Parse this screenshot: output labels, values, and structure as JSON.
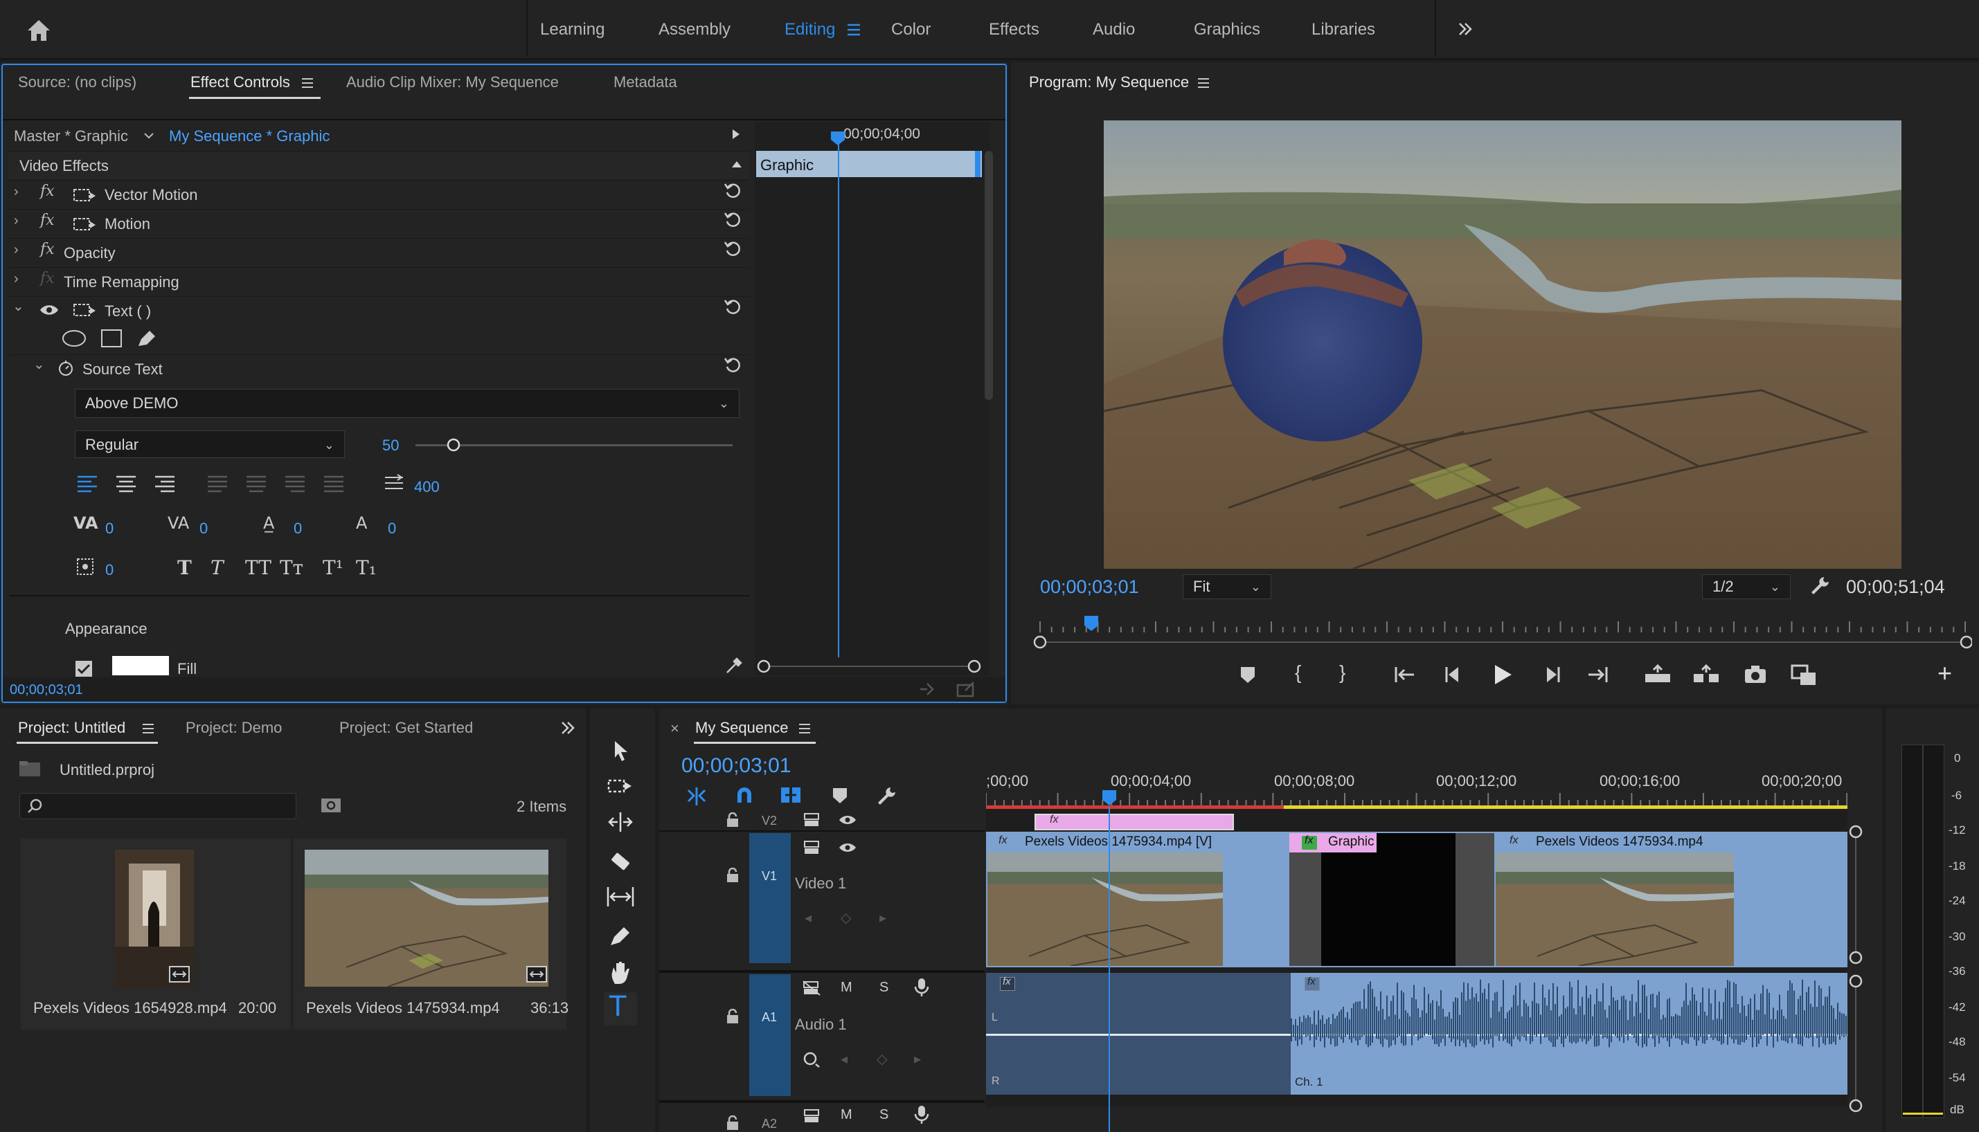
{
  "workspaces": [
    "Learning",
    "Assembly",
    "Editing",
    "Color",
    "Effects",
    "Audio",
    "Graphics",
    "Libraries"
  ],
  "effectPanel": {
    "tabs": [
      "Source: (no clips)",
      "Effect Controls",
      "Audio Clip Mixer: My Sequence",
      "Metadata"
    ],
    "master": "Master * Graphic",
    "sequence": "My Sequence * Graphic",
    "rulerTime": "00;00;04;00",
    "clipName": "Graphic",
    "sectionTitle": "Video Effects",
    "effects": [
      "Vector Motion",
      "Motion",
      "Opacity",
      "Time Remapping",
      "Text ( )"
    ],
    "sourceText": "Source Text",
    "textValue": "Above DEMO",
    "fontStyle": "Regular",
    "fontSize": "50",
    "tracking": "400",
    "kerning": "0",
    "leading": "0",
    "baseline": "0",
    "tsume": "0",
    "rotation": "0",
    "appearance": "Appearance",
    "fill": "Fill",
    "timecode": "00;00;03;01"
  },
  "program": {
    "title": "Program: My Sequence",
    "timecode": "00;00;03;01",
    "zoom": "Fit",
    "resolution": "1/2",
    "duration": "00;00;51;04"
  },
  "project": {
    "tabs": [
      "Project: Untitled",
      "Project: Demo",
      "Project: Get Started"
    ],
    "file": "Untitled.prproj",
    "count": "2 Items",
    "items": [
      {
        "name": "Pexels Videos 1654928.mp4",
        "dur": "20:00"
      },
      {
        "name": "Pexels Videos 1475934.mp4",
        "dur": "36:13"
      }
    ]
  },
  "timeline": {
    "title": "My Sequence",
    "timecode": "00;00;03;01",
    "ruler": [
      ";00;00",
      "00;00;04;00",
      "00;00;08;00",
      "00;00;12;00",
      "00;00;16;00",
      "00;00;20;00"
    ],
    "tracks": {
      "v2": "V2",
      "v1": "V1",
      "video1": "Video 1",
      "a1": "A1",
      "audio1": "Audio 1",
      "a2": "A2",
      "m": "M",
      "s": "S"
    },
    "clips": {
      "clip1": "Pexels Videos 1475934.mp4 [V]",
      "graphic": "Graphic",
      "clip2": "Pexels Videos 1475934.mp4",
      "fx": "fx",
      "ch1": "Ch. 1",
      "l": "L",
      "r": "R"
    }
  },
  "meter": {
    "labels": [
      "0",
      "-6",
      "-12",
      "-18",
      "-24",
      "-30",
      "-36",
      "-42",
      "-48",
      "-54",
      "dB"
    ]
  }
}
